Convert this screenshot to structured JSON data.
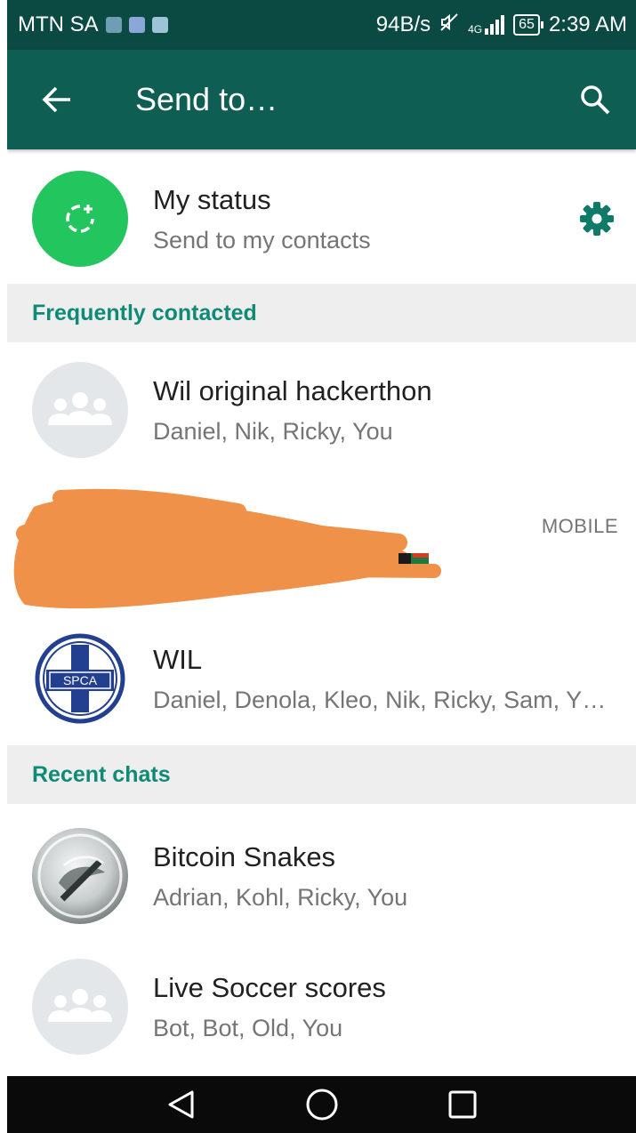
{
  "status_bar": {
    "carrier": "MTN SA",
    "net_speed": "94B/s",
    "network_type": "4G",
    "battery": "65",
    "time": "2:39 AM"
  },
  "toolbar": {
    "title": "Send to…"
  },
  "my_status": {
    "title": "My status",
    "subtitle": "Send to my contacts"
  },
  "sections": {
    "frequent": "Frequently contacted",
    "recent": "Recent chats"
  },
  "frequent_contacts": [
    {
      "name": "Wil original hackerthon",
      "subtitle": "Daniel, Nik, Ricky, You"
    },
    {
      "tag": "MOBILE"
    },
    {
      "name": "WIL",
      "subtitle": "Daniel, Denola, Kleo, Nik, Ricky, Sam, Y…",
      "avatar_text": "SPCA"
    }
  ],
  "recent_chats": [
    {
      "name": "Bitcoin Snakes",
      "subtitle": "Adrian, Kohl, Ricky, You"
    },
    {
      "name": "Live Soccer scores",
      "subtitle": "Bot, Bot, Old, You"
    }
  ],
  "colors": {
    "status_bar": "#0b4a42",
    "toolbar": "#0e5e53",
    "accent": "#0f8a77",
    "status_green": "#22c55e",
    "redaction": "#f0914a"
  },
  "icons": {
    "back": "arrow-left",
    "search": "magnifier",
    "status_add": "status-add",
    "settings": "gear",
    "group": "group-people",
    "nav_back": "triangle-left",
    "nav_home": "circle",
    "nav_recents": "square"
  }
}
